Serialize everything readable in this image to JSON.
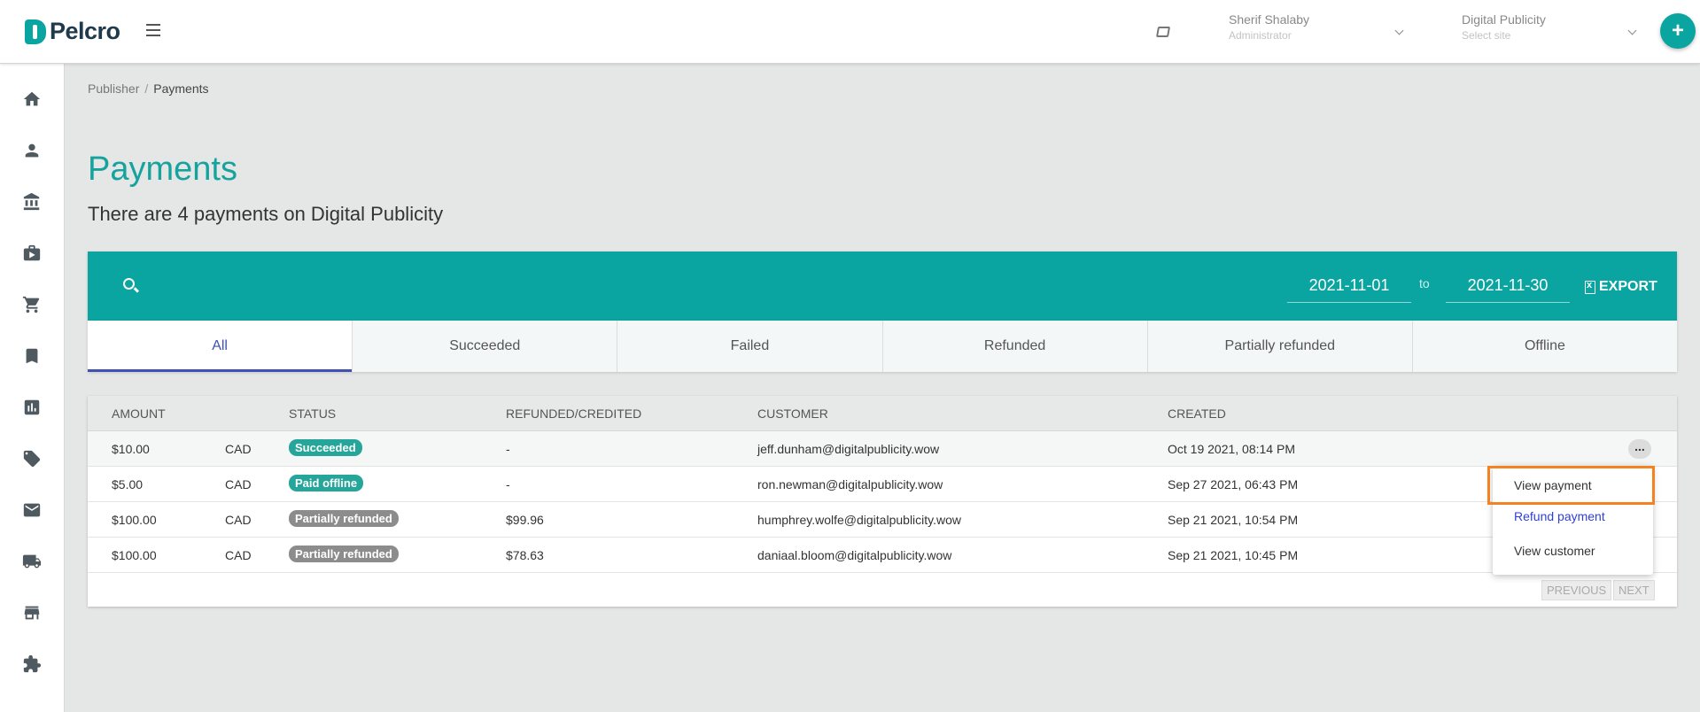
{
  "brand": {
    "name": "Pelcro",
    "accent": "#0aa5a0"
  },
  "header": {
    "user_name": "Sherif Shalaby",
    "user_role": "Administrator",
    "site_name": "Digital Publicity",
    "site_placeholder": "Select site",
    "add_label": "+"
  },
  "sidebar": {
    "items": [
      {
        "icon": "home-icon"
      },
      {
        "icon": "person-icon"
      },
      {
        "icon": "bank-icon"
      },
      {
        "icon": "briefcase-icon"
      },
      {
        "icon": "cart-icon"
      },
      {
        "icon": "bookmark-icon"
      },
      {
        "icon": "chart-icon"
      },
      {
        "icon": "ticket-icon"
      },
      {
        "icon": "mail-icon"
      },
      {
        "icon": "truck-icon"
      },
      {
        "icon": "store-icon"
      },
      {
        "icon": "puzzle-icon"
      }
    ]
  },
  "breadcrumb": {
    "parent": "Publisher",
    "separator": "/",
    "current": "Payments"
  },
  "page": {
    "title": "Payments",
    "subtitle": "There are 4 payments on Digital Publicity"
  },
  "filters": {
    "date_from": "2021-11-01",
    "to_label": "to",
    "date_to": "2021-11-30",
    "export_label": "EXPORT"
  },
  "tabs": [
    {
      "label": "All",
      "active": true
    },
    {
      "label": "Succeeded"
    },
    {
      "label": "Failed"
    },
    {
      "label": "Refunded"
    },
    {
      "label": "Partially refunded"
    },
    {
      "label": "Offline"
    }
  ],
  "table": {
    "headers": {
      "amount": "AMOUNT",
      "status": "STATUS",
      "refunded": "REFUNDED/CREDITED",
      "customer": "CUSTOMER",
      "created": "CREATED"
    },
    "rows": [
      {
        "amount": "$10.00",
        "currency": "CAD",
        "status": "Succeeded",
        "status_color": "#26a69a",
        "refunded": "-",
        "customer": "jeff.dunham@digitalpublicity.wow",
        "created": "Oct 19 2021, 08:14 PM"
      },
      {
        "amount": "$5.00",
        "currency": "CAD",
        "status": "Paid offline",
        "status_color": "#26a69a",
        "refunded": "-",
        "customer": "ron.newman@digitalpublicity.wow",
        "created": "Sep 27 2021, 06:43 PM"
      },
      {
        "amount": "$100.00",
        "currency": "CAD",
        "status": "Partially refunded",
        "status_color": "#8c8c8c",
        "refunded": "$99.96",
        "customer": "humphrey.wolfe@digitalpublicity.wow",
        "created": "Sep 21 2021, 10:54 PM"
      },
      {
        "amount": "$100.00",
        "currency": "CAD",
        "status": "Partially refunded",
        "status_color": "#8c8c8c",
        "refunded": "$78.63",
        "customer": "daniaal.bloom@digitalpublicity.wow",
        "created": "Sep 21 2021, 10:45 PM"
      }
    ],
    "more_label": "...",
    "pager": {
      "previous": "PREVIOUS",
      "next": "NEXT"
    }
  },
  "row_menu": {
    "items": [
      {
        "label": "View payment",
        "color": "#333333"
      },
      {
        "label": "Refund payment",
        "color": "#2f3fd6"
      },
      {
        "label": "View customer",
        "color": "#333333"
      }
    ]
  }
}
